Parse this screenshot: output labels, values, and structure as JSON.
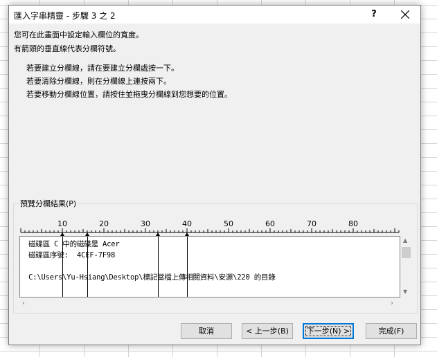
{
  "dialog": {
    "title": "匯入字串精靈 - 步驟 3 之 2",
    "help": "?"
  },
  "description": [
    "您可在此畫面中設定輸入欄位的寬度。",
    "有箭頭的垂直線代表分欄符號。"
  ],
  "hints": [
    "若要建立分欄線，請在要建立分欄處按一下。",
    "若要清除分欄線，則在分欄線上連按兩下。",
    "若要移動分欄線位置，請按住並拖曳分欄線到您想要的位置。"
  ],
  "preview": {
    "label": "預覽分欄結果(P)",
    "ruler_labels": [
      "10",
      "20",
      "30",
      "40",
      "50",
      "60",
      "70",
      "80"
    ],
    "column_breaks": [
      10,
      16,
      33,
      40
    ],
    "lines": [
      " 磁碟區 C 中的磁碟是 Acer",
      " 磁碟區序號:  4CEF-7F98",
      "",
      " C:\\Users\\Yu-Hsiang\\Desktop\\標記當檔上傳相關資料\\安源\\220 的目錄"
    ]
  },
  "buttons": {
    "cancel": "取消",
    "back": "< 上一步(B)",
    "next": "下一步(N) >",
    "finish": "完成(F)"
  }
}
